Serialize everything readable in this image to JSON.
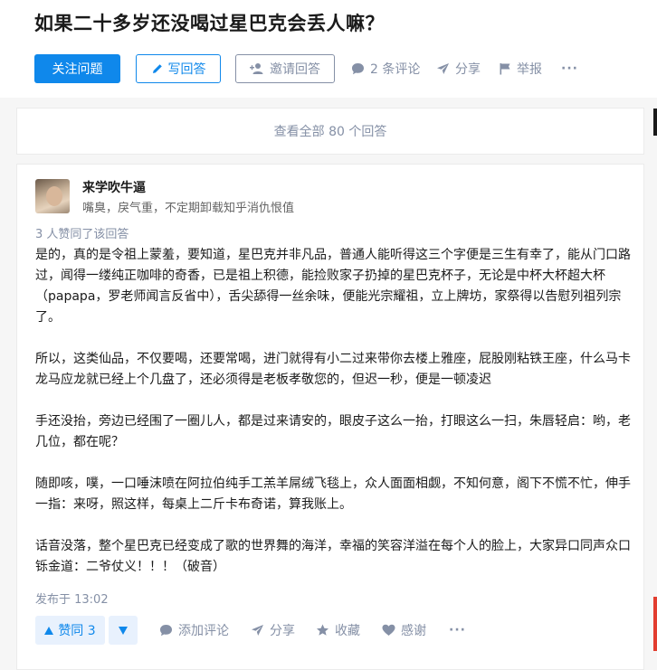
{
  "question": {
    "title": "如果二十多岁还没喝过星巴克会丢人嘛？",
    "follow_label": "关注问题",
    "write_label": "写回答",
    "invite_label": "邀请回答",
    "comments_label": "2 条评论",
    "share_label": "分享",
    "report_label": "举报",
    "more_label": "···"
  },
  "view_all_label": "查看全部 80 个回答",
  "answer": {
    "author_name": "来学吹牛逼",
    "author_headline": "嘴臭，戾气重，不定期卸载知乎消仇恨值",
    "votes_text": "3 人赞同了该回答",
    "paragraphs": [
      "是的，真的是令祖上蒙羞，要知道，星巴克并非凡品，普通人能听得这三个字便是三生有幸了，能从门口路过，闻得一缕纯正咖啡的奇香，已是祖上积德，能捡败家子扔掉的星巴克杯子，无论是中杯大杯超大杯（papapa，罗老师闻言反省中），舌尖舔得一丝余味，便能光宗耀祖，立上牌坊，家祭得以告慰列祖列宗了。",
      "所以，这类仙品，不仅要喝，还要常喝，进门就得有小二过来带你去楼上雅座，屁股刚粘铁王座，什么马卡龙马应龙就已经上个几盘了，还必须得是老板孝敬您的，但迟一秒，便是一顿凌迟",
      "手还没抬，旁边已经围了一圈儿人，都是过来请安的，眼皮子这么一抬，打眼这么一扫，朱唇轻启：哟，老几位，都在呢？",
      "随即咳，噗，一口唾沫喷在阿拉伯纯手工羔羊屌绒飞毯上，众人面面相觑，不知何意，阁下不慌不忙，伸手一指：来呀，照这样，每桌上二斤卡布奇诺，算我账上。",
      "话音没落，整个星巴克已经变成了歌的世界舞的海洋，幸福的笑容洋溢在每个人的脸上，大家异口同声众口铄金道：二爷仗义！！！（破音）"
    ],
    "posted_text": "发布于 13:02",
    "upvote_label": "赞同 3",
    "add_comment_label": "添加评论",
    "share_label": "分享",
    "collect_label": "收藏",
    "thanks_label": "感谢",
    "more_label": "···"
  },
  "colors": {
    "brand_blue": "#0f88eb",
    "gray_text": "#8590a6"
  }
}
